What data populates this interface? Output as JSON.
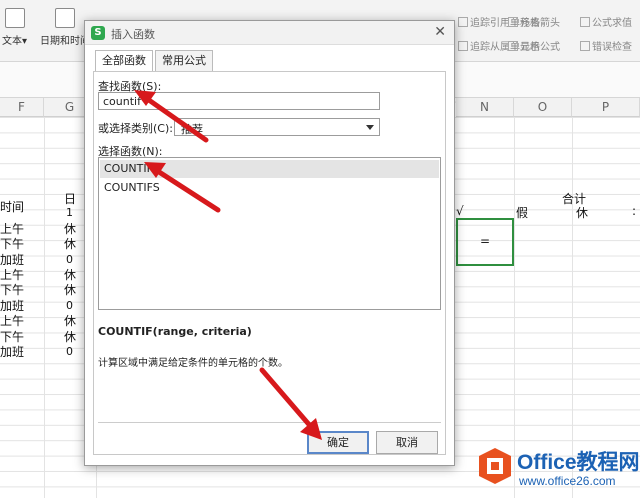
{
  "ribbon": {
    "buttons": [
      "文本",
      "日期和时间"
    ],
    "small_items": [
      "追踪引用单元格",
      "移去箭头",
      "公式求值",
      "追踪从属单元格",
      "显示公式",
      "错误检查"
    ],
    "row1": [
      "追踪引用单元格",
      "移去箭头",
      "公式求值"
    ],
    "row2": [
      "追踪从属单元格",
      "显示公式",
      "错误检查"
    ]
  },
  "sheet": {
    "columns": [
      "F",
      "G",
      "N",
      "O",
      "P"
    ],
    "header_left": "日",
    "day_number": "1",
    "time_label": "时间",
    "rows": [
      {
        "label": "上午",
        "value": "休"
      },
      {
        "label": "下午",
        "value": "休"
      },
      {
        "label": "加班",
        "value": "0"
      },
      {
        "label": "上午",
        "value": "休"
      },
      {
        "label": "下午",
        "value": "休"
      },
      {
        "label": "加班",
        "value": "0"
      },
      {
        "label": "上午",
        "value": "休"
      },
      {
        "label": "下午",
        "value": "休"
      },
      {
        "label": "加班",
        "value": "0"
      }
    ],
    "total_label": "合计",
    "check_mark": "√",
    "leave_label": "假",
    "rest_label": "休",
    "colon": ":",
    "selected_cell_value": "="
  },
  "dialog": {
    "title": "插入函数",
    "tabs": [
      "全部函数",
      "常用公式"
    ],
    "search_label": "查找函数(S):",
    "search_value": "countif",
    "category_label": "或选择类别(C):",
    "category_value": "推荐",
    "select_label": "选择函数(N):",
    "functions": [
      "COUNTIF",
      "COUNTIFS"
    ],
    "selected_function": "COUNTIF",
    "signature": "COUNTIF(range, criteria)",
    "description": "计算区域中满足给定条件的单元格的个数。",
    "ok_label": "确定",
    "cancel_label": "取消"
  },
  "watermark": {
    "brand": "Office教程网",
    "url": "www.office26.com"
  },
  "colors": {
    "dialog_logo": "#2fa84f",
    "arrow": "#d7191c",
    "selection_border": "#2f8f3f",
    "primary_border": "#5a87c9",
    "watermark": "#1c62b4"
  }
}
